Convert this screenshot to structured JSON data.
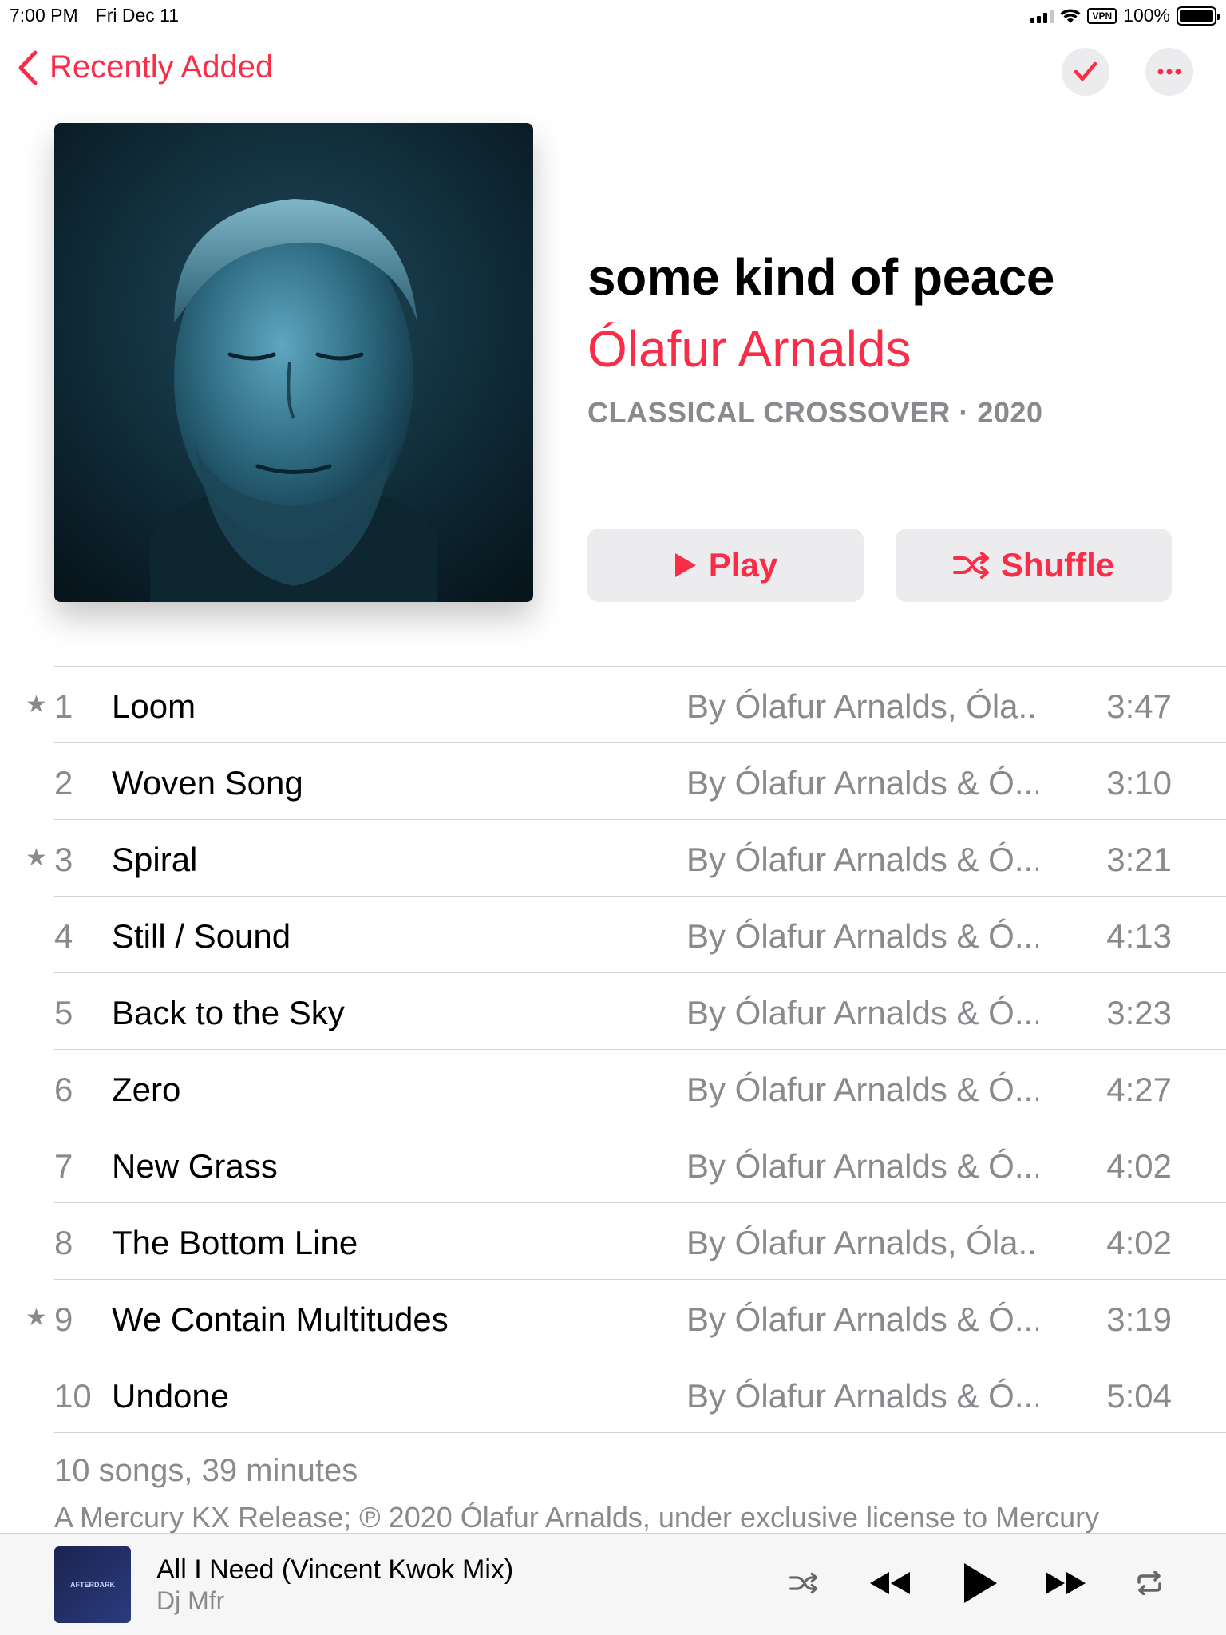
{
  "status_bar": {
    "time": "7:00 PM",
    "date": "Fri Dec 11",
    "vpn": "VPN",
    "battery": "100%"
  },
  "nav": {
    "back_label": "Recently Added"
  },
  "album": {
    "title": "some kind of peace",
    "artist": "Ólafur Arnalds",
    "meta": "CLASSICAL CROSSOVER · 2020",
    "play_label": "Play",
    "shuffle_label": "Shuffle"
  },
  "tracks": [
    {
      "num": "1",
      "title": "Loom",
      "artist": "By Ólafur Arnalds, Óla...",
      "duration": "3:47",
      "starred": true
    },
    {
      "num": "2",
      "title": "Woven Song",
      "artist": "By Ólafur Arnalds & Ó...",
      "duration": "3:10",
      "starred": false
    },
    {
      "num": "3",
      "title": "Spiral",
      "artist": "By Ólafur Arnalds & Ó...",
      "duration": "3:21",
      "starred": true
    },
    {
      "num": "4",
      "title": "Still / Sound",
      "artist": "By Ólafur Arnalds & Ó...",
      "duration": "4:13",
      "starred": false
    },
    {
      "num": "5",
      "title": "Back to the Sky",
      "artist": "By Ólafur Arnalds & Ó...",
      "duration": "3:23",
      "starred": false
    },
    {
      "num": "6",
      "title": "Zero",
      "artist": "By Ólafur Arnalds & Ó...",
      "duration": "4:27",
      "starred": false
    },
    {
      "num": "7",
      "title": "New Grass",
      "artist": "By Ólafur Arnalds & Ó...",
      "duration": "4:02",
      "starred": false
    },
    {
      "num": "8",
      "title": "The Bottom Line",
      "artist": "By Ólafur Arnalds, Óla...",
      "duration": "4:02",
      "starred": false
    },
    {
      "num": "9",
      "title": "We Contain Multitudes",
      "artist": "By Ólafur Arnalds & Ó...",
      "duration": "3:19",
      "starred": true
    },
    {
      "num": "10",
      "title": "Undone",
      "artist": "By Ólafur Arnalds & Ó...",
      "duration": "5:04",
      "starred": false
    }
  ],
  "summary": "10 songs, 39 minutes",
  "copyright": "A Mercury KX Release; ℗ 2020 Ólafur Arnalds, under exclusive license to Mercury",
  "mini_player": {
    "title": "All I Need (Vincent Kwok Mix)",
    "artist": "Dj Mfr",
    "art_text": "AFTERDARK"
  },
  "colors": {
    "accent": "#fa2d48",
    "secondary_text": "#8a8a8e",
    "button_bg": "#ececee"
  },
  "icons": {
    "back": "chevron-left-icon",
    "check": "checkmark-icon",
    "more": "ellipsis-icon",
    "play": "play-icon",
    "shuffle": "shuffle-icon",
    "star": "star-icon",
    "rewind": "rewind-icon",
    "fast_forward": "fast-forward-icon",
    "repeat": "repeat-icon"
  }
}
